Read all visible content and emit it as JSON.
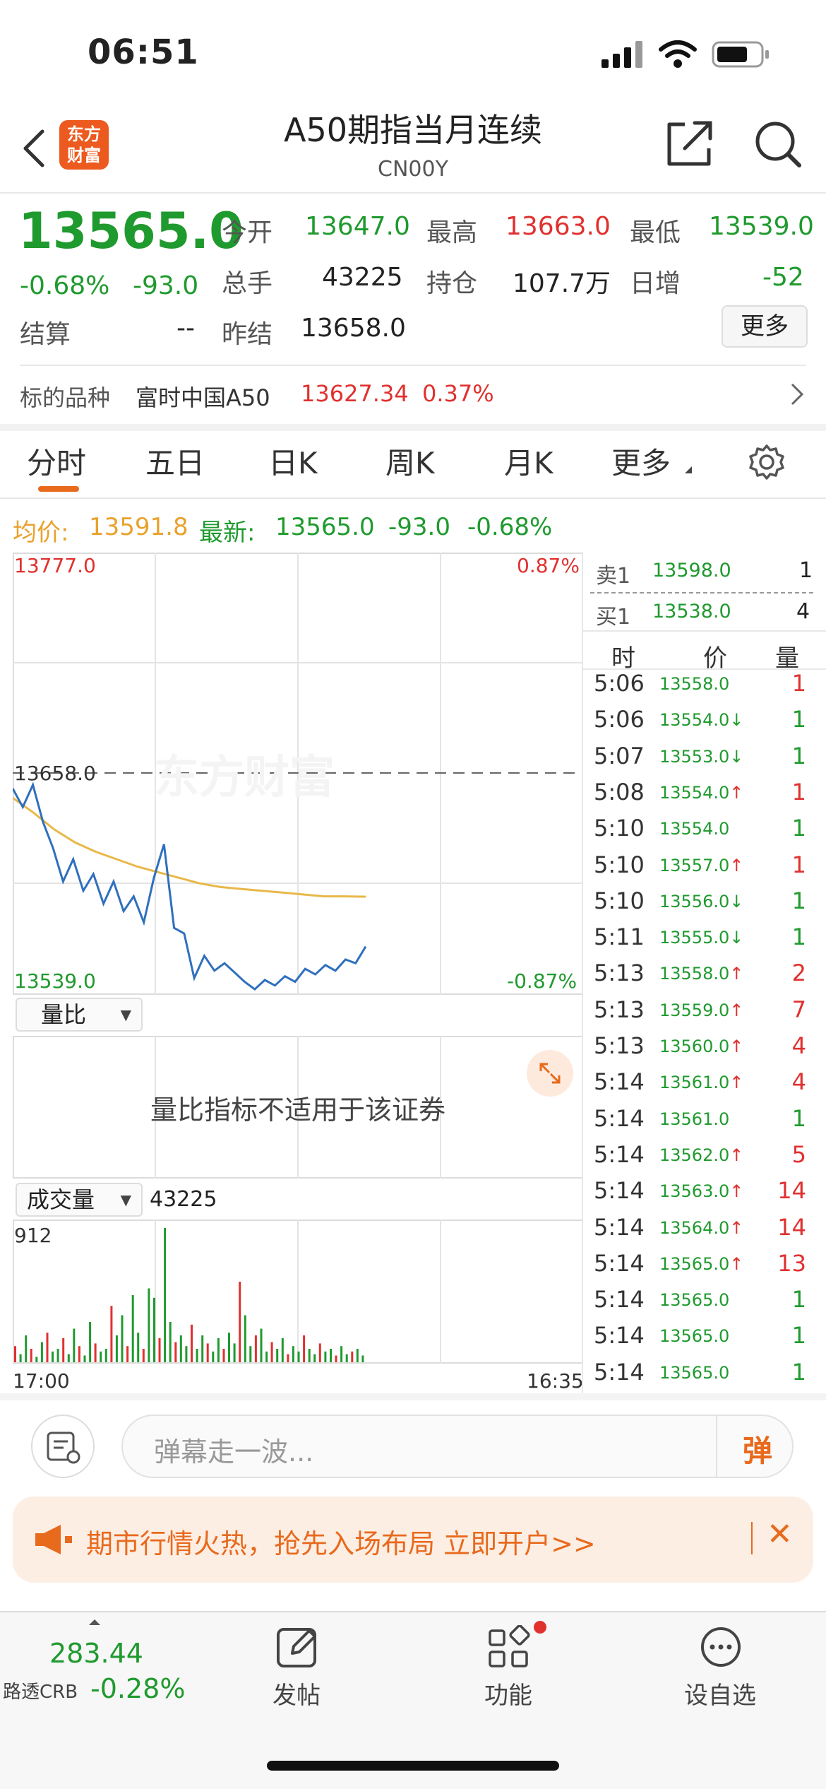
{
  "status": {
    "time": "06:51"
  },
  "header": {
    "logo_text_line1": "东方",
    "logo_text_line2": "财富",
    "title": "A50期指当月连续",
    "subtitle": "CN00Y"
  },
  "quote": {
    "price": "13565.0",
    "change_pct": "-0.68%",
    "change": "-93.0",
    "open_label": "今开",
    "open": "13647.0",
    "high_label": "最高",
    "high": "13663.0",
    "low_label": "最低",
    "low": "13539.0",
    "volume_label": "总手",
    "volume": "43225",
    "oi_label": "持仓",
    "oi": "107.7万",
    "daily_inc_label": "日增",
    "daily_inc": "-52",
    "settle_label": "结算",
    "settle": "--",
    "prev_settle_label": "昨结",
    "prev_settle": "13658.0",
    "more_button": "更多"
  },
  "underlying": {
    "label": "标的品种",
    "name": "富时中国A50",
    "price": "13627.34",
    "pct": "0.37%"
  },
  "tabs": [
    "分时",
    "五日",
    "日K",
    "周K",
    "月K",
    "更多"
  ],
  "active_tab": 0,
  "chart_info": {
    "avg_label": "均价:",
    "avg": "13591.8",
    "latest_label": "最新:",
    "latest": "13565.0",
    "chg": "-93.0",
    "pct": "-0.68%"
  },
  "chart_data": {
    "type": "line",
    "y_top": "13777.0",
    "y_mid": "13658.0",
    "y_bottom": "13539.0",
    "pct_top": "0.87%",
    "pct_bottom": "-0.87%",
    "ylim": [
      13539.0,
      13777.0
    ],
    "series": [
      {
        "values": [
          13650,
          13640,
          13652,
          13632,
          13618,
          13600,
          13612,
          13595,
          13604,
          13588,
          13600,
          13584,
          13592,
          13578,
          13602,
          13620,
          13575,
          13572,
          13548,
          13560,
          13552,
          13556,
          13551,
          13546,
          13542,
          13547,
          13544,
          13549,
          13546,
          13553,
          13550,
          13555,
          13552,
          13558,
          13556,
          13565
        ]
      },
      {
        "values": [
          13645,
          13637,
          13628,
          13621,
          13616,
          13612,
          13608,
          13605,
          13602,
          13599,
          13597,
          13596,
          13595,
          13594,
          13593,
          13592,
          13592,
          13591.8
        ]
      }
    ],
    "volume_max": "912",
    "volume_total": "43225",
    "volume_bars": [
      0.12,
      0.06,
      0.2,
      0.1,
      0.04,
      0.15,
      0.22,
      0.08,
      0.1,
      0.18,
      0.06,
      0.25,
      0.12,
      0.05,
      0.3,
      0.14,
      0.08,
      0.1,
      0.42,
      0.2,
      0.35,
      0.12,
      0.5,
      0.22,
      0.1,
      0.55,
      0.48,
      0.18,
      1.0,
      0.3,
      0.15,
      0.2,
      0.12,
      0.28,
      0.1,
      0.2,
      0.14,
      0.08,
      0.18,
      0.1,
      0.22,
      0.14,
      0.6,
      0.35,
      0.12,
      0.2,
      0.25,
      0.08,
      0.15,
      0.1,
      0.18,
      0.06,
      0.12,
      0.08,
      0.2,
      0.1,
      0.06,
      0.14,
      0.08,
      0.1,
      0.05,
      0.12,
      0.06,
      0.08,
      0.1,
      0.05
    ],
    "time_start": "17:00",
    "time_end": "16:35"
  },
  "sub_panels": {
    "ratio_dropdown": "量比",
    "ratio_message": "量比指标不适用于该证券",
    "volume_dropdown": "成交量",
    "volume_value": "43225"
  },
  "order_book": {
    "ask_label": "卖1",
    "ask_price": "13598.0",
    "ask_qty": "1",
    "bid_label": "买1",
    "bid_price": "13538.0",
    "bid_qty": "4",
    "col_time": "时",
    "col_price": "价",
    "col_qty": "量"
  },
  "ticks": [
    {
      "t": "5:06",
      "p": "13558.0",
      "a": "",
      "v": "1",
      "vc": "r"
    },
    {
      "t": "5:06",
      "p": "13554.0",
      "a": "↓",
      "v": "1",
      "vc": "g"
    },
    {
      "t": "5:07",
      "p": "13553.0",
      "a": "↓",
      "v": "1",
      "vc": "g"
    },
    {
      "t": "5:08",
      "p": "13554.0",
      "a": "↑",
      "v": "1",
      "vc": "r"
    },
    {
      "t": "5:10",
      "p": "13554.0",
      "a": "",
      "v": "1",
      "vc": "g"
    },
    {
      "t": "5:10",
      "p": "13557.0",
      "a": "↑",
      "v": "1",
      "vc": "r"
    },
    {
      "t": "5:10",
      "p": "13556.0",
      "a": "↓",
      "v": "1",
      "vc": "g"
    },
    {
      "t": "5:11",
      "p": "13555.0",
      "a": "↓",
      "v": "1",
      "vc": "g"
    },
    {
      "t": "5:13",
      "p": "13558.0",
      "a": "↑",
      "v": "2",
      "vc": "r"
    },
    {
      "t": "5:13",
      "p": "13559.0",
      "a": "↑",
      "v": "7",
      "vc": "r"
    },
    {
      "t": "5:13",
      "p": "13560.0",
      "a": "↑",
      "v": "4",
      "vc": "r"
    },
    {
      "t": "5:14",
      "p": "13561.0",
      "a": "↑",
      "v": "4",
      "vc": "r"
    },
    {
      "t": "5:14",
      "p": "13561.0",
      "a": "",
      "v": "1",
      "vc": "g"
    },
    {
      "t": "5:14",
      "p": "13562.0",
      "a": "↑",
      "v": "5",
      "vc": "r"
    },
    {
      "t": "5:14",
      "p": "13563.0",
      "a": "↑",
      "v": "14",
      "vc": "r"
    },
    {
      "t": "5:14",
      "p": "13564.0",
      "a": "↑",
      "v": "14",
      "vc": "r"
    },
    {
      "t": "5:14",
      "p": "13565.0",
      "a": "↑",
      "v": "13",
      "vc": "r"
    },
    {
      "t": "5:14",
      "p": "13565.0",
      "a": "",
      "v": "1",
      "vc": "g"
    },
    {
      "t": "5:14",
      "p": "13565.0",
      "a": "",
      "v": "1",
      "vc": "g"
    },
    {
      "t": "5:14",
      "p": "13565.0",
      "a": "",
      "v": "1",
      "vc": "g"
    }
  ],
  "danmu": {
    "placeholder": "弹幕走一波...",
    "button": "弹"
  },
  "banner": {
    "text": "期市行情火热，抢先入场布局 立即开户>>"
  },
  "bottom_nav": {
    "ticker_value": "283.44",
    "ticker_name": "路透CRB",
    "ticker_pct": "-0.28%",
    "post": "发帖",
    "functions": "功能",
    "watchlist": "设自选"
  },
  "watermark": "东方财富",
  "colors": {
    "up": "#e0312f",
    "down": "#1f9a2e",
    "accent": "#e86a1d",
    "avg_line": "#e8b84a",
    "price_line": "#2f6fbd"
  }
}
